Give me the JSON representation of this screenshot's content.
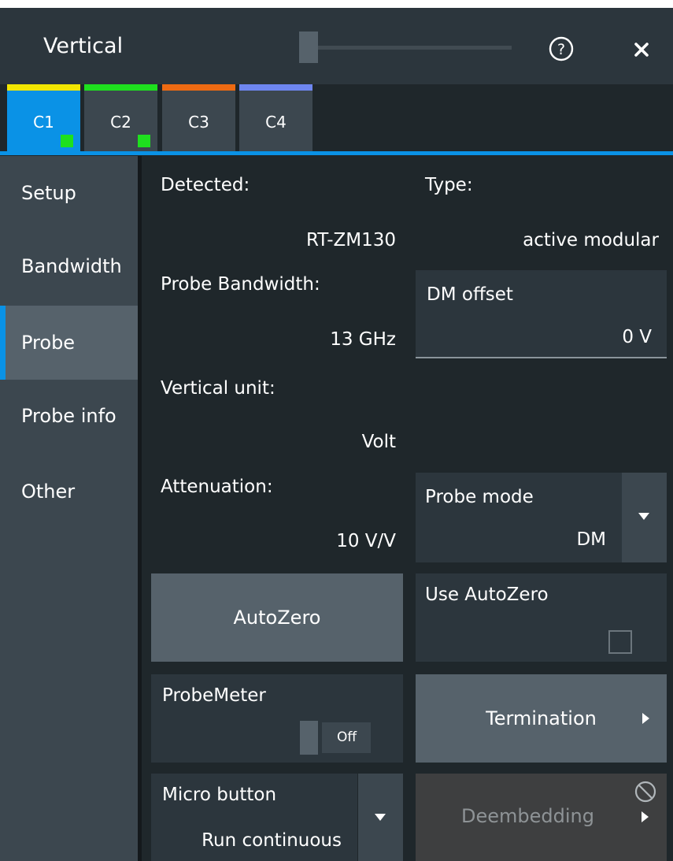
{
  "window": {
    "title": "Vertical",
    "help_icon": "help-circle-icon",
    "close_icon": "close-icon"
  },
  "tabs": [
    {
      "label": "C1",
      "color": "#f2e600",
      "active": true,
      "indicator": true
    },
    {
      "label": "C2",
      "color": "#1ee01e",
      "active": false,
      "indicator": true
    },
    {
      "label": "C3",
      "color": "#ee6a12",
      "active": false,
      "indicator": false
    },
    {
      "label": "C4",
      "color": "#6e86f0",
      "active": false,
      "indicator": false
    }
  ],
  "sidebar": {
    "items": [
      {
        "label": "Setup"
      },
      {
        "label": "Bandwidth"
      },
      {
        "label": "Probe",
        "active": true
      },
      {
        "label": "Probe info"
      },
      {
        "label": "Other"
      }
    ]
  },
  "probe": {
    "detected_label": "Detected:",
    "detected_value": "RT-ZM130",
    "type_label": "Type:",
    "type_value": "active modular",
    "bandwidth_label": "Probe Bandwidth:",
    "bandwidth_value": "13 GHz",
    "dm_offset": {
      "label": "DM offset",
      "value": "0 V"
    },
    "vertical_unit_label": "Vertical unit:",
    "vertical_unit_value": "Volt",
    "attenuation_label": "Attenuation:",
    "attenuation_value": "10 V/V",
    "probe_mode": {
      "label": "Probe mode",
      "value": "DM"
    },
    "autozero_button": "AutoZero",
    "use_autozero": {
      "label": "Use AutoZero",
      "checked": false
    },
    "probemeter": {
      "label": "ProbeMeter",
      "state": "Off"
    },
    "termination_button": "Termination",
    "micro_button": {
      "label": "Micro button",
      "value": "Run continuous"
    },
    "deembedding_button": "Deembedding",
    "deembedding_disabled_icon": "disabled-circle-icon"
  },
  "colors": {
    "accent": "#0a92e6",
    "background": "#1f272b"
  }
}
